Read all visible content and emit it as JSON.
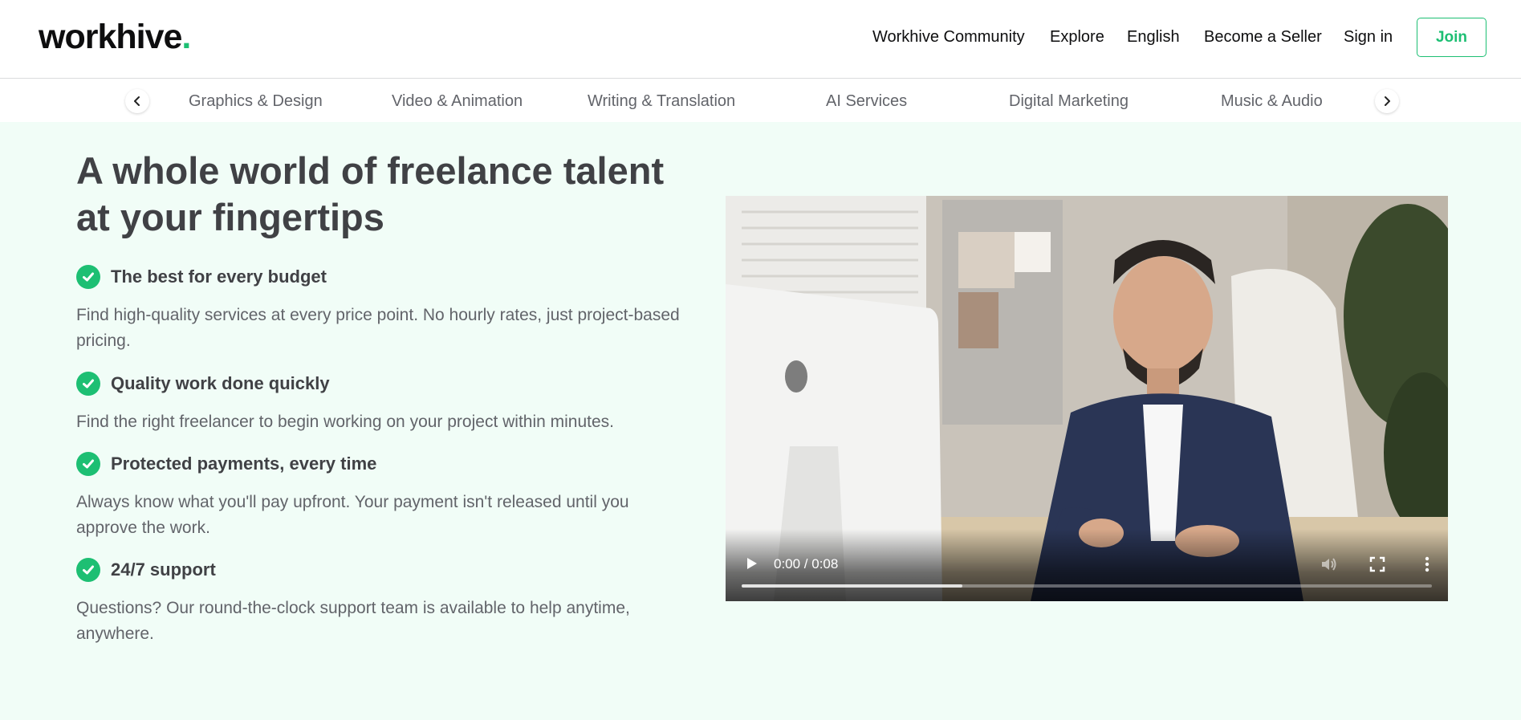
{
  "header": {
    "logo_text": "workhive",
    "logo_dot": ".",
    "nav": [
      "Workhive Community",
      "Explore",
      "English",
      "Become a Seller",
      "Sign in"
    ],
    "join_label": "Join"
  },
  "categories": {
    "items": [
      "Graphics & Design",
      "Video & Animation",
      "Writing & Translation",
      "AI Services",
      "Digital Marketing",
      "Music & Audio"
    ],
    "prev_icon": "chevron-left-icon",
    "next_icon": "chevron-right-icon"
  },
  "hero": {
    "title_line1": "A whole world of freelance talent",
    "title_line2": "at your fingertips",
    "features": [
      {
        "title": "The best for every budget",
        "desc": "Find high-quality services at every price point. No hourly rates, just project-based pricing."
      },
      {
        "title": "Quality work done quickly",
        "desc": "Find the right freelancer to begin working on your project within minutes."
      },
      {
        "title": "Protected payments, every time",
        "desc": "Always know what you'll pay upfront. Your payment isn't released until you approve the work."
      },
      {
        "title": "24/7 support",
        "desc": "Questions? Our round-the-clock support team is available to help anytime, anywhere."
      }
    ]
  },
  "video": {
    "time": "0:00 / 0:08",
    "buffered": 0.32
  },
  "colors": {
    "accent": "#1dbf73",
    "hero_bg": "#f1fdf7",
    "text": "#404145",
    "muted": "#62646a"
  }
}
